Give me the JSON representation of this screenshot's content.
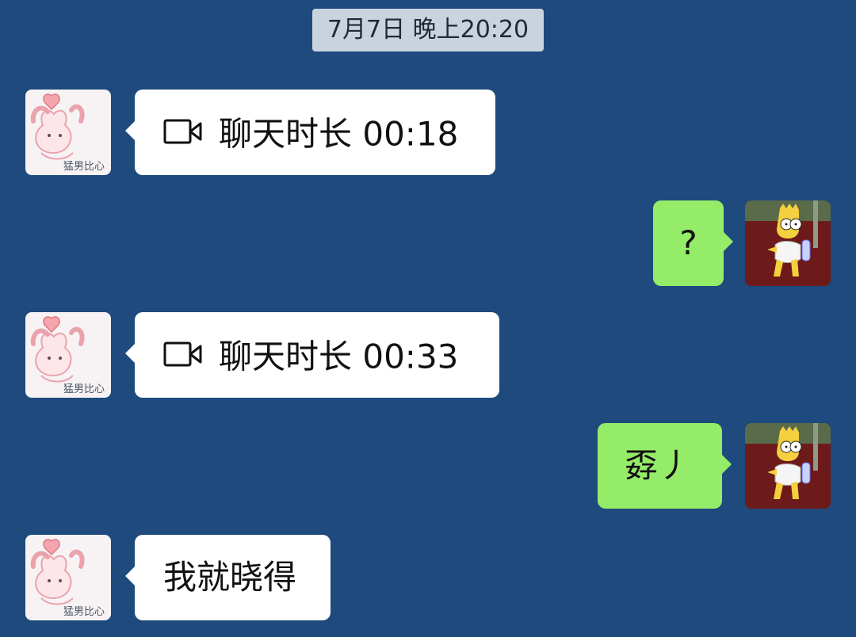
{
  "timestamp": "7月7日 晚上20:20",
  "contact": {
    "avatar_caption": "猛男比心"
  },
  "messages": [
    {
      "side": "in",
      "kind": "call",
      "icon": "video-call-icon",
      "text": "聊天时长 00:18"
    },
    {
      "side": "out",
      "kind": "text",
      "text": "?"
    },
    {
      "side": "in",
      "kind": "call",
      "icon": "video-call-icon",
      "text": "聊天时长 00:33"
    },
    {
      "side": "out",
      "kind": "text",
      "text": "孬丿"
    },
    {
      "side": "in",
      "kind": "text",
      "text": "我就晓得"
    }
  ],
  "colors": {
    "background": "#1e4a7d",
    "incoming_bubble": "#ffffff",
    "outgoing_bubble": "#95ec69",
    "timestamp_bg": "#c9d3dd"
  }
}
